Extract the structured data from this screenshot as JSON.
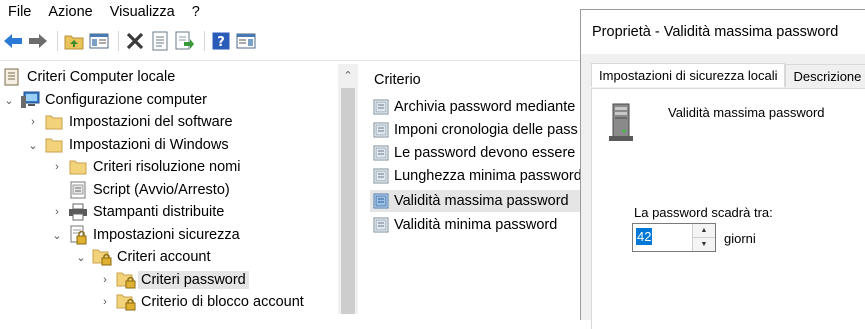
{
  "menu": [
    "File",
    "Azione",
    "Visualizza",
    "?"
  ],
  "toolbar": {
    "buttons": [
      "back-icon",
      "forward-icon",
      "up-folder-icon",
      "show-hide-tree-icon",
      "delete-icon",
      "properties-icon",
      "export-list-icon",
      "help-icon",
      "show-action-pane-icon"
    ]
  },
  "tree": {
    "items": [
      {
        "label": "Criteri Computer locale"
      },
      {
        "label": "Configurazione computer"
      },
      {
        "label": "Impostazioni del software"
      },
      {
        "label": "Impostazioni di Windows"
      },
      {
        "label": "Criteri risoluzione nomi"
      },
      {
        "label": "Script (Avvio/Arresto)"
      },
      {
        "label": "Stampanti distribuite"
      },
      {
        "label": "Impostazioni sicurezza"
      },
      {
        "label": "Criteri account"
      },
      {
        "label": "Criteri password"
      },
      {
        "label": "Criterio di blocco account"
      }
    ]
  },
  "list": {
    "column": "Criterio",
    "rows": [
      {
        "label": "Archivia password mediante c"
      },
      {
        "label": "Imponi cronologia delle pass"
      },
      {
        "label": "Le password devono essere c"
      },
      {
        "label": "Lunghezza minima password"
      },
      {
        "label": "Validità massima password"
      },
      {
        "label": "Validità minima password"
      }
    ]
  },
  "dialog": {
    "title": "Proprietà - Validità massima password",
    "tabs": [
      "Impostazioni di sicurezza locali",
      "Descrizione"
    ],
    "policy_name": "Validità massima password",
    "expire_label": "La password scadrà tra:",
    "value": "42",
    "unit": "giorni"
  },
  "colors": {
    "selection": "#0078d7",
    "selected_row": "#e5e5e5",
    "dialog_bg": "#f0f0f0"
  }
}
